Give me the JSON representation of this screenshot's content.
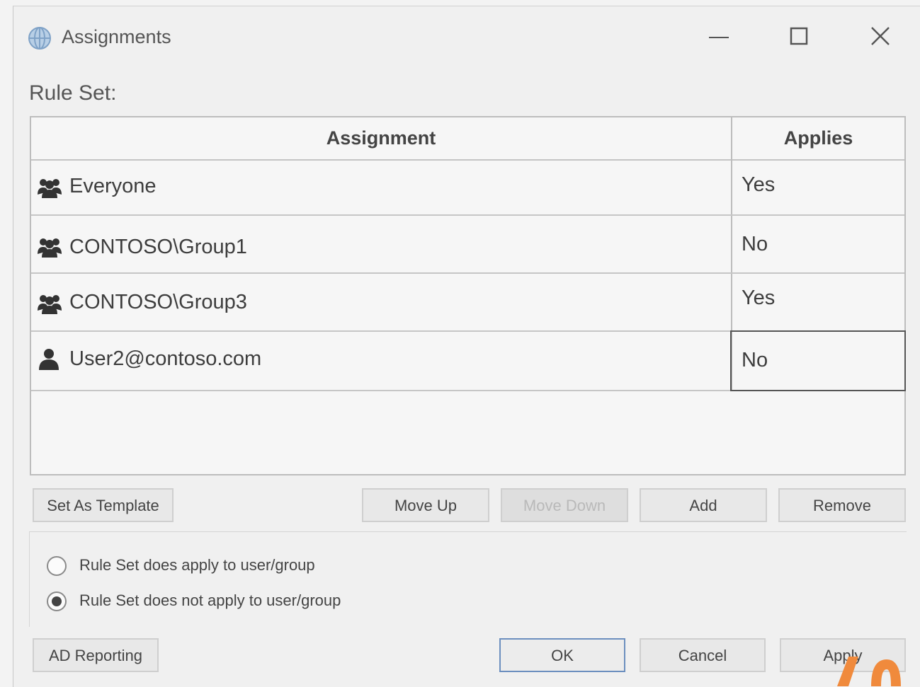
{
  "window": {
    "title": "Assignments"
  },
  "ruleset_label": "Rule Set:",
  "table": {
    "columns": [
      "Assignment",
      "Applies"
    ],
    "rows": [
      {
        "icon": "group-icon",
        "name": "Everyone",
        "applies": "Yes"
      },
      {
        "icon": "group-icon",
        "name": "CONTOSO\\Group1",
        "applies": "No"
      },
      {
        "icon": "group-icon",
        "name": "CONTOSO\\Group3",
        "applies": "Yes"
      },
      {
        "icon": "user-icon",
        "name": "User2@contoso.com",
        "applies": "No"
      }
    ]
  },
  "buttons": {
    "set_as_template": "Set As Template",
    "move_up": "Move Up",
    "move_down": "Move Down",
    "add": "Add",
    "remove": "Remove",
    "ad_reporting": "AD Reporting",
    "ok": "OK",
    "cancel": "Cancel",
    "apply": "Apply"
  },
  "options": {
    "applies": {
      "label": "Rule Set does apply to user/group",
      "selected": false
    },
    "not_applies": {
      "label": "Rule Set does not apply to user/group",
      "selected": true
    }
  },
  "colors": {
    "accent_border": "#6c8fbf",
    "watermark": "#f08a3c"
  }
}
